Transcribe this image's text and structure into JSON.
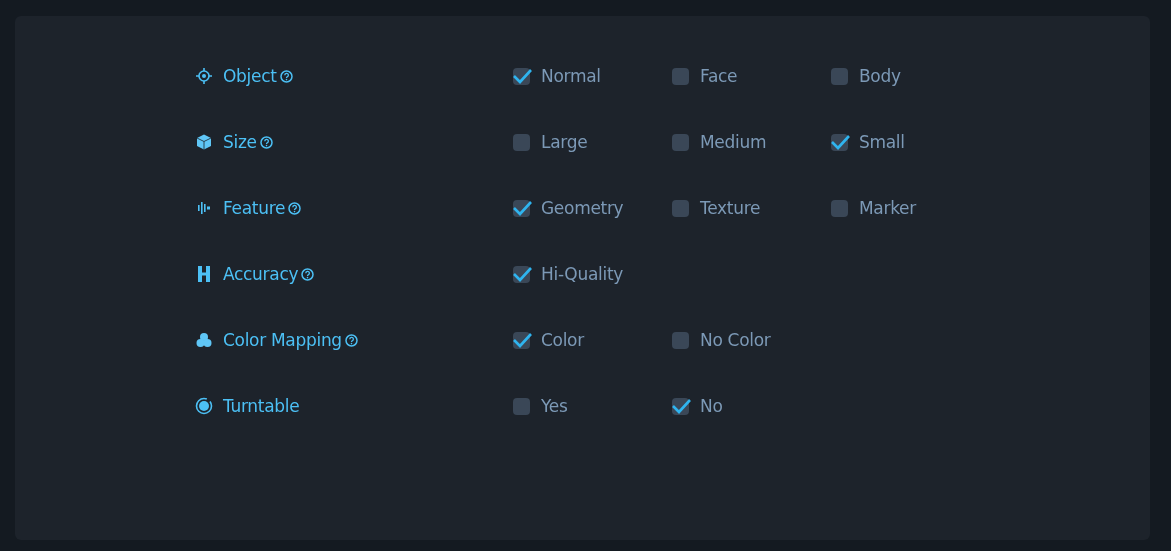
{
  "settings": [
    {
      "label": "Object",
      "help": true,
      "options": [
        {
          "label": "Normal",
          "checked": true
        },
        {
          "label": "Face",
          "checked": false
        },
        {
          "label": "Body",
          "checked": false
        }
      ]
    },
    {
      "label": "Size",
      "help": true,
      "options": [
        {
          "label": "Large",
          "checked": false
        },
        {
          "label": "Medium",
          "checked": false
        },
        {
          "label": "Small",
          "checked": true
        }
      ]
    },
    {
      "label": "Feature",
      "help": true,
      "options": [
        {
          "label": "Geometry",
          "checked": true
        },
        {
          "label": "Texture",
          "checked": false
        },
        {
          "label": "Marker",
          "checked": false
        }
      ]
    },
    {
      "label": "Accuracy",
      "help": true,
      "options": [
        {
          "label": "Hi-Quality",
          "checked": true
        }
      ]
    },
    {
      "label": "Color Mapping",
      "help": true,
      "options": [
        {
          "label": "Color",
          "checked": true
        },
        {
          "label": "No Color",
          "checked": false
        }
      ]
    },
    {
      "label": "Turntable",
      "help": false,
      "options": [
        {
          "label": "Yes",
          "checked": false
        },
        {
          "label": "No",
          "checked": true
        }
      ]
    }
  ]
}
